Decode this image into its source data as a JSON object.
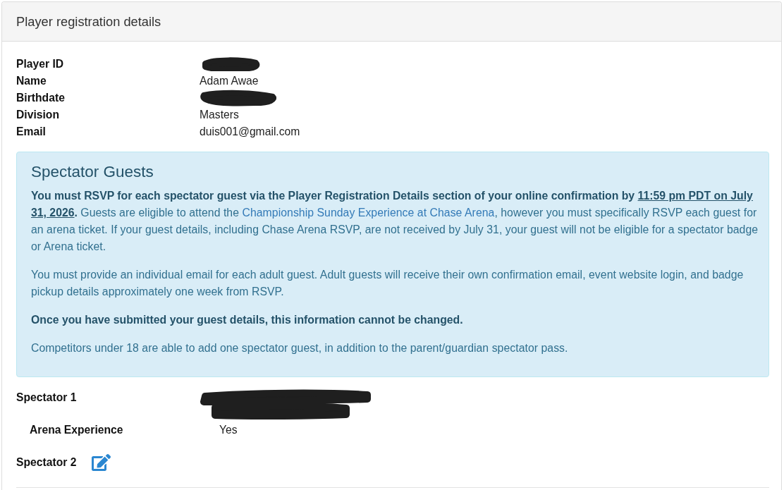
{
  "panel": {
    "title": "Player registration details"
  },
  "details": [
    {
      "label": "Player ID",
      "kind": "redacted"
    },
    {
      "label": "Name",
      "kind": "text",
      "value": "Adam Awae"
    },
    {
      "label": "Birthdate",
      "kind": "redacted"
    },
    {
      "label": "Division",
      "kind": "text",
      "value": "Masters"
    },
    {
      "label": "Email",
      "kind": "text",
      "value": "duis001@gmail.com"
    }
  ],
  "alert": {
    "title": "Spectator Guests",
    "paragraphs": [
      {
        "kind": "mixed",
        "segments": [
          {
            "kind": "bold",
            "text": "You must RSVP for each spectator guest via the Player Registration Details section of your online confirmation by "
          },
          {
            "kind": "underline",
            "text": "11:59 pm PDT on July 31, 2026"
          },
          {
            "kind": "bold",
            "text": "."
          },
          {
            "kind": "plain",
            "text": " Guests are eligible to attend the "
          },
          {
            "kind": "link",
            "text": "Championship Sunday Experience at Chase Arena"
          },
          {
            "kind": "plain",
            "text": ", however you must specifically RSVP each guest for an arena ticket. If your guest details, including Chase Arena RSVP, are not received by July 31, your guest will not be eligible for a spectator badge or Arena ticket."
          }
        ]
      },
      {
        "kind": "plain",
        "text": "You must provide an individual email for each adult guest. Adult guests will receive their own confirmation email, event website login, and badge pickup details approximately one week from RSVP."
      },
      {
        "kind": "bold",
        "text": "Once you have submitted your guest details, this information cannot be changed."
      },
      {
        "kind": "plain",
        "text": "Competitors under 18 are able to add one spectator guest, in addition to the parent/guardian spectator pass."
      }
    ]
  },
  "spectators": [
    {
      "label": "Spectator 1",
      "kind": "filled",
      "value": {
        "kind": "redacted"
      },
      "details": [
        {
          "label": "Arena Experience",
          "value": "Yes"
        }
      ]
    },
    {
      "label": "Spectator 2",
      "kind": "empty"
    }
  ]
}
